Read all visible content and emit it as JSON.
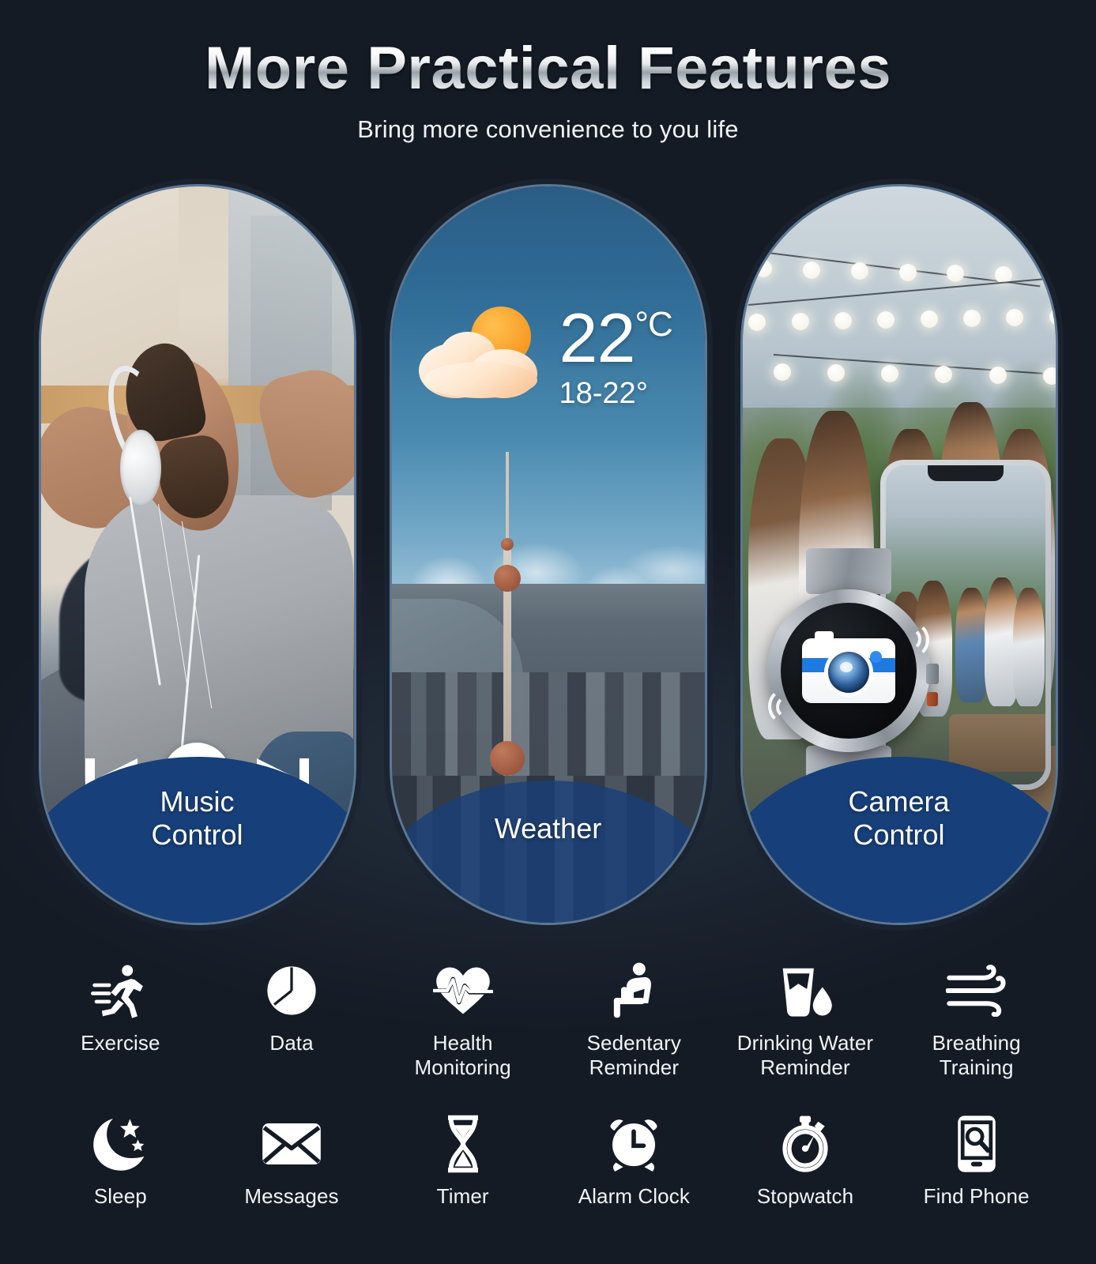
{
  "header": {
    "title": "More Practical Features",
    "subtitle": "Bring more convenience to you life"
  },
  "colors": {
    "background": "#151b25",
    "card_border": "#5b7794",
    "label_blue": "#173f7a",
    "accent_blue": "#1f7ae0",
    "icon_white": "#ffffff",
    "sun_orange": "#f79a24"
  },
  "cards": [
    {
      "id": "music-control",
      "label": "Music\nControl",
      "label_style": "solid",
      "scene": "man-with-headphones-relaxing",
      "controls": [
        {
          "name": "previous-track-button",
          "glyph": "prev"
        },
        {
          "name": "pause-button",
          "glyph": "pause"
        },
        {
          "name": "next-track-button",
          "glyph": "next"
        }
      ]
    },
    {
      "id": "weather",
      "label": "Weather",
      "label_style": "translucent",
      "scene": "city-skyline-daytime",
      "weather": {
        "temperature": "22",
        "unit": "°C",
        "range": "18-22°",
        "icon": "sun-behind-cloud-icon"
      }
    },
    {
      "id": "camera-control",
      "label": "Camera\nControl",
      "label_style": "solid",
      "scene": "friends-party-rooftop",
      "device": {
        "watch_icon": "camera-icon",
        "phone_preview": "party-scene-preview"
      }
    }
  ],
  "features": [
    {
      "label": "Exercise",
      "icon": "running-person-icon"
    },
    {
      "label": "Data",
      "icon": "pie-chart-icon"
    },
    {
      "label": "Health\nMonitoring",
      "icon": "heart-pulse-icon"
    },
    {
      "label": "Sedentary\nReminder",
      "icon": "seated-person-icon"
    },
    {
      "label": "Drinking Water\nReminder",
      "icon": "water-glass-droplet-icon"
    },
    {
      "label": "Breathing\nTraining",
      "icon": "wind-icon"
    },
    {
      "label": "Sleep",
      "icon": "crescent-moon-stars-icon"
    },
    {
      "label": "Messages",
      "icon": "envelope-icon"
    },
    {
      "label": "Timer",
      "icon": "hourglass-icon"
    },
    {
      "label": "Alarm Clock",
      "icon": "alarm-clock-icon"
    },
    {
      "label": "Stopwatch",
      "icon": "stopwatch-icon"
    },
    {
      "label": "Find Phone",
      "icon": "phone-search-icon"
    }
  ]
}
